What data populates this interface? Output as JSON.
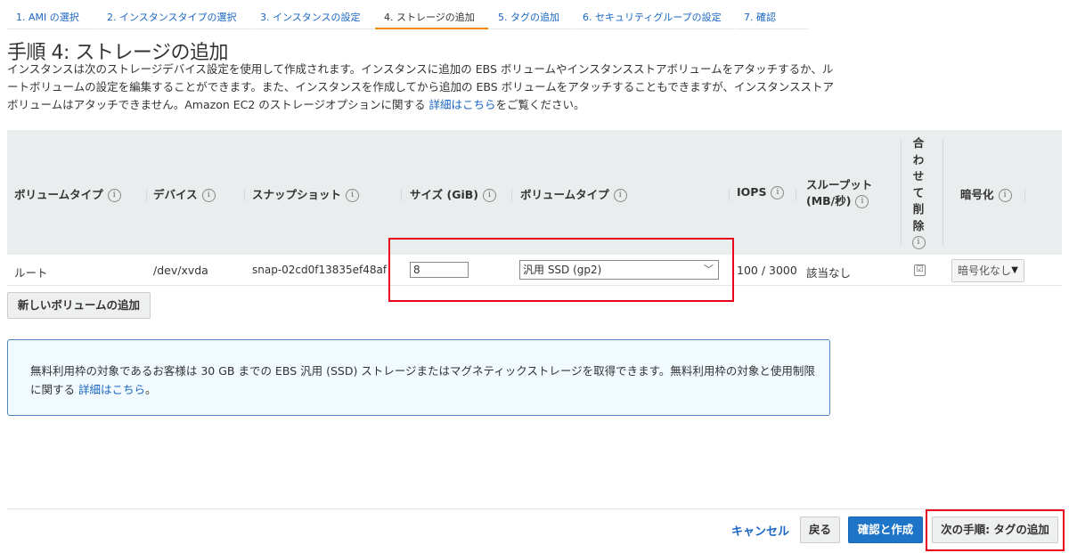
{
  "tabs": [
    {
      "label": "1. AMI の選択"
    },
    {
      "label": "2. インスタンスタイプの選択"
    },
    {
      "label": "3. インスタンスの設定"
    },
    {
      "label": "4. ストレージの追加"
    },
    {
      "label": "5. タグの追加"
    },
    {
      "label": "6. セキュリティグループの設定"
    },
    {
      "label": "7. 確認"
    }
  ],
  "page": {
    "title": "手順 4: ストレージの追加",
    "description_1": "インスタンスは次のストレージデバイス設定を使用して作成されます。インスタンスに追加の EBS ボリュームやインスタンスストアボリュームをアタッチするか、ルートボリュームの設定を編集することができます。また、インスタンスを作成してから追加の EBS ボリュームをアタッチすることもできますが、インスタンスストアボリュームはアタッチできません。Amazon EC2 のストレージオプションに関する ",
    "description_link": "詳細はこちら",
    "description_2": "をご覧ください。"
  },
  "table": {
    "headers": {
      "volume_type": "ボリュームタイプ",
      "device": "デバイス",
      "snapshot": "スナップショット",
      "size": "サイズ (GiB)",
      "volume_type2": "ボリュームタイプ",
      "iops": "IOPS",
      "throughput_1": "スループット",
      "throughput_2": "(MB/秒)",
      "delete_chars": [
        "合",
        "わ",
        "せ",
        "て",
        "削",
        "除"
      ],
      "encryption": "暗号化"
    },
    "info_icon": "i",
    "row": {
      "volume_type": "ルート",
      "device": "/dev/xvda",
      "snapshot": "snap-02cd0f13835ef48af",
      "size": "8",
      "volume_type_selected": "汎用 SSD (gp2)",
      "iops": "100 / 3000",
      "throughput": "該当なし",
      "delete_on_termination_mark": "☑",
      "encryption_selected": "暗号化なし"
    }
  },
  "add_volume_button": "新しいボリュームの追加",
  "notice": {
    "text": "無料利用枠の対象であるお客様は 30 GB までの EBS 汎用 (SSD) ストレージまたはマグネティックストレージを取得できます。無料利用枠の対象と使用制限に関する ",
    "link": "詳細はこちら",
    "suffix": "。"
  },
  "footer": {
    "cancel": "キャンセル",
    "back": "戻る",
    "review_launch": "確認と作成",
    "next": "次の手順: タグの追加"
  },
  "colors": {
    "link": "#1a66c2",
    "active_tab_underline": "#eb8c00",
    "primary_button": "#1e74c6",
    "highlight_box": "#e8001c",
    "notice_bg": "#f1faff",
    "table_header_bg": "#eaeded"
  }
}
